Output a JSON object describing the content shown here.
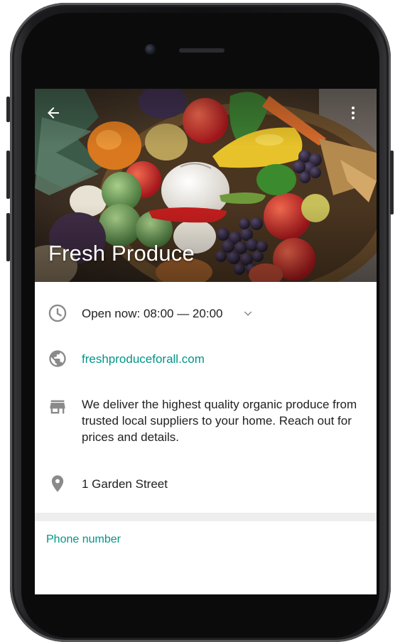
{
  "header": {
    "title": "Fresh Produce",
    "back_icon": "arrow-back-icon",
    "more_icon": "more-vert-icon"
  },
  "details": {
    "hours": "Open now: 08:00 — 20:00",
    "website": "freshproduceforall.com",
    "description": "We deliver the highest quality organic produce from trusted local suppliers to your home. Reach out for prices and details.",
    "address": "1 Garden Street"
  },
  "contact": {
    "phone_label": "Phone number"
  },
  "colors": {
    "accent": "#009688",
    "icon_gray": "#8a8a8a",
    "text": "#212121",
    "divider": "#eeeeee"
  }
}
